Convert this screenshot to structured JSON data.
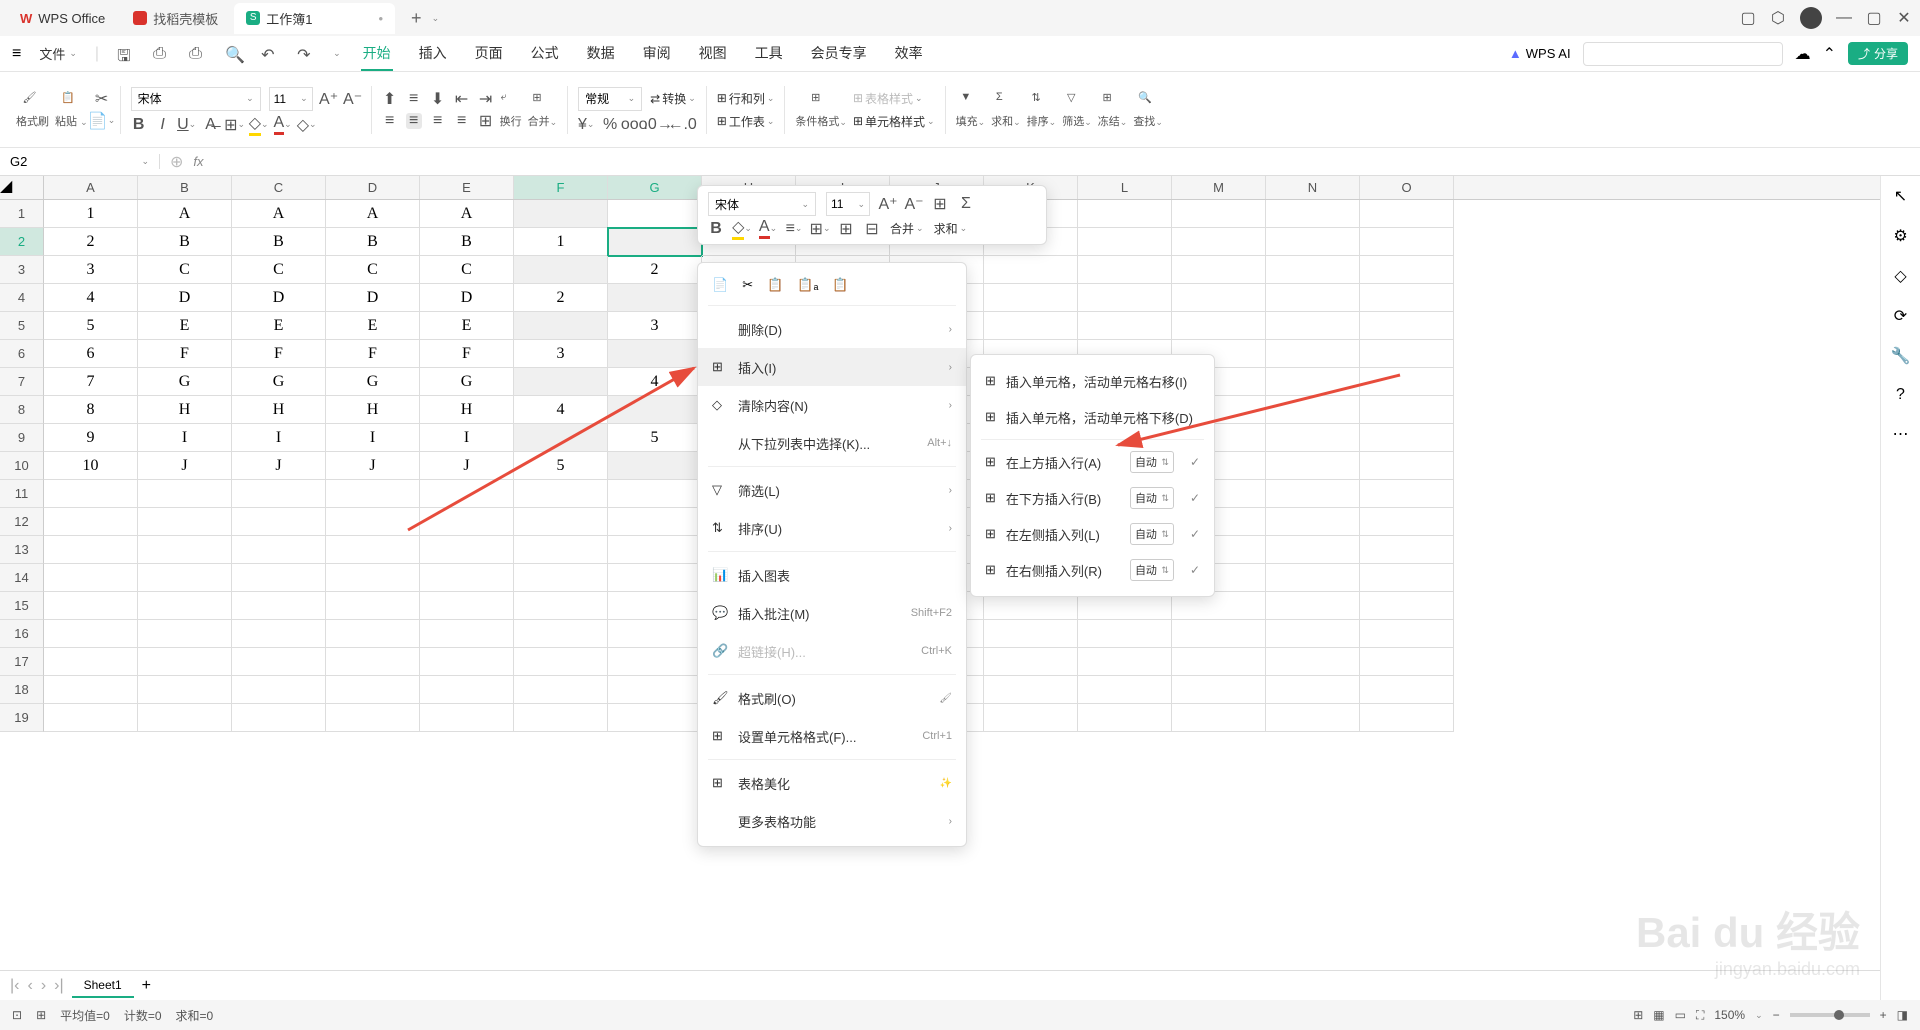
{
  "tabs": {
    "wps": "WPS Office",
    "template": "找稻壳模板",
    "workbook": "工作簿1",
    "add": "+"
  },
  "menu": {
    "file": "文件",
    "tabs": [
      "开始",
      "插入",
      "页面",
      "公式",
      "数据",
      "审阅",
      "视图",
      "工具",
      "会员专享",
      "效率"
    ],
    "active_index": 0,
    "ai": "WPS AI",
    "share": "分享"
  },
  "ribbon": {
    "format_painter": "格式刷",
    "paste": "粘贴",
    "font_name": "宋体",
    "font_size": "11",
    "number_format": "常规",
    "wrap": "换行",
    "merge": "合并",
    "convert": "转换",
    "rowcol": "行和列",
    "worksheet": "工作表",
    "cond_fmt": "条件格式",
    "cell_style": "单元格样式",
    "table_style": "表格样式",
    "fill": "填充",
    "sum": "求和",
    "sort": "排序",
    "filter": "筛选",
    "freeze": "冻结",
    "find": "查找"
  },
  "formula_bar": {
    "cell_ref": "G2",
    "fx": "fx"
  },
  "columns": [
    "A",
    "B",
    "C",
    "D",
    "E",
    "F",
    "G",
    "H",
    "I",
    "J",
    "K",
    "L",
    "M",
    "N",
    "O"
  ],
  "selected_cols": [
    "F",
    "G"
  ],
  "selected_row": 2,
  "grid_data": [
    {
      "r": "1",
      "A": "1",
      "B": "A",
      "C": "A",
      "D": "A",
      "E": "A",
      "F": "",
      "G": ""
    },
    {
      "r": "2",
      "A": "2",
      "B": "B",
      "C": "B",
      "D": "B",
      "E": "B",
      "F": "1",
      "G": ""
    },
    {
      "r": "3",
      "A": "3",
      "B": "C",
      "C": "C",
      "D": "C",
      "E": "C",
      "F": "",
      "G": "2"
    },
    {
      "r": "4",
      "A": "4",
      "B": "D",
      "C": "D",
      "D": "D",
      "E": "D",
      "F": "2",
      "G": ""
    },
    {
      "r": "5",
      "A": "5",
      "B": "E",
      "C": "E",
      "D": "E",
      "E": "E",
      "F": "",
      "G": "3"
    },
    {
      "r": "6",
      "A": "6",
      "B": "F",
      "C": "F",
      "D": "F",
      "E": "F",
      "F": "3",
      "G": ""
    },
    {
      "r": "7",
      "A": "7",
      "B": "G",
      "C": "G",
      "D": "G",
      "E": "G",
      "F": "",
      "G": "4"
    },
    {
      "r": "8",
      "A": "8",
      "B": "H",
      "C": "H",
      "D": "H",
      "E": "H",
      "F": "4",
      "G": ""
    },
    {
      "r": "9",
      "A": "9",
      "B": "I",
      "C": "I",
      "D": "I",
      "E": "I",
      "F": "",
      "G": "5"
    },
    {
      "r": "10",
      "A": "10",
      "B": "J",
      "C": "J",
      "D": "J",
      "E": "J",
      "F": "5",
      "G": ""
    }
  ],
  "empty_rows": [
    "11",
    "12",
    "13",
    "14",
    "15",
    "16",
    "17",
    "18",
    "19"
  ],
  "mini_toolbar": {
    "font": "宋体",
    "size": "11",
    "merge": "合并",
    "sum": "求和"
  },
  "context_menu": {
    "delete": "删除(D)",
    "insert": "插入(I)",
    "clear": "清除内容(N)",
    "select_from": "从下拉列表中选择(K)...",
    "select_from_sc": "Alt+↓",
    "filter": "筛选(L)",
    "sort": "排序(U)",
    "insert_chart": "插入图表",
    "insert_comment": "插入批注(M)",
    "insert_comment_sc": "Shift+F2",
    "hyperlink": "超链接(H)...",
    "hyperlink_sc": "Ctrl+K",
    "format_painter": "格式刷(O)",
    "format_cells": "设置单元格格式(F)...",
    "format_cells_sc": "Ctrl+1",
    "beautify": "表格美化",
    "more": "更多表格功能"
  },
  "sub_menu": {
    "shift_right": "插入单元格，活动单元格右移(I)",
    "shift_down": "插入单元格，活动单元格下移(D)",
    "insert_row_above": "在上方插入行(A)",
    "insert_row_below": "在下方插入行(B)",
    "insert_col_left": "在左侧插入列(L)",
    "insert_col_right": "在右侧插入列(R)",
    "auto": "自动"
  },
  "sheet": {
    "name": "Sheet1"
  },
  "status": {
    "avg": "平均值=0",
    "count": "计数=0",
    "sum": "求和=0",
    "zoom": "150%"
  },
  "watermark": {
    "main": "Bai du 经验",
    "sub": "jingyan.baidu.com"
  }
}
